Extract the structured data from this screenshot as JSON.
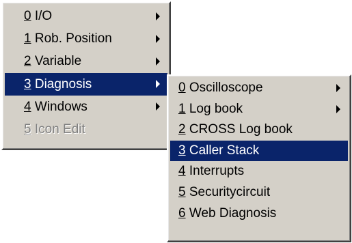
{
  "main_menu": {
    "items": [
      {
        "mnemonic": "0",
        "text": " I/O"
      },
      {
        "mnemonic": "1",
        "text": " Rob. Position"
      },
      {
        "mnemonic": "2",
        "text": " Variable"
      },
      {
        "mnemonic": "3",
        "text": " Diagnosis"
      },
      {
        "mnemonic": "4",
        "text": " Windows"
      },
      {
        "mnemonic": "5",
        "text": " Icon Edit"
      }
    ],
    "selected": "3 Diagnosis",
    "disabled": [
      "5 Icon Edit"
    ]
  },
  "diagnosis_submenu": {
    "items": [
      {
        "mnemonic": "0",
        "text": " Oscilloscope"
      },
      {
        "mnemonic": "1",
        "text": " Log book"
      },
      {
        "mnemonic": "2",
        "text": " CROSS Log book"
      },
      {
        "mnemonic": "3",
        "text": " Caller Stack"
      },
      {
        "mnemonic": "4",
        "text": " Interrupts"
      },
      {
        "mnemonic": "5",
        "text": " Securitycircuit"
      },
      {
        "mnemonic": "6",
        "text": " Web Diagnosis"
      }
    ],
    "selected": "3 Caller Stack"
  },
  "colors": {
    "menu_background": "#d4d0c8",
    "highlight_background": "#0a246a",
    "highlight_text": "#ffffff",
    "disabled_text": "#808080"
  },
  "icons": {
    "submenu_arrow": "triangle-right-icon"
  }
}
